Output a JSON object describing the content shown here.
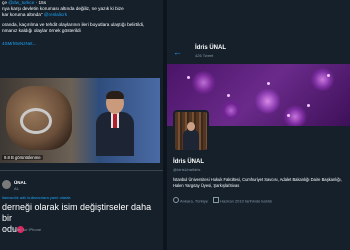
{
  "left": {
    "post_lines": [
      {
        "prefix": "çe",
        "link": "@dw_turkce",
        "rest": " · 15s"
      },
      {
        "prefix": "",
        "link": "",
        "rest": "nya karşı devletin koruması altında değiliz, ne yazık ki bize"
      },
      {
        "prefix": "",
        "link": "",
        "rest": "kar koruma altında\" "
      },
      {
        "prefix": "",
        "link": "",
        "rest": ""
      },
      {
        "prefix": "",
        "link": "",
        "rest": "oranda, kaçırılma ve tehdit olaylarının ileri boyutlara ulaştığı belirtildi,"
      },
      {
        "prefix": "",
        "link": "",
        "rest": "nmanız kaldığı olaylar örnek gösterildi"
      }
    ],
    "post_link": "@reslalicrk",
    "quote_link": "4SMrh9vNzNet...",
    "views": "9.8 B görüntülenme",
    "tweet2": {
      "name": "ÜNAL",
      "handle": "AL",
      "reply_prefix": "llamacılık adlı kullanıcılara yanıt olarak",
      "text": "derneği olarak isim değiştirseler daha bir",
      "text2": "odu",
      "meta": "15 · Twitter for iPhone"
    }
  },
  "right": {
    "top_name": "İdris ÜNAL",
    "top_count": "426 Tweet",
    "name": "İdris ÜNAL",
    "handle": "@IdrisUnalIdris",
    "bio": "İstanbul Üniversitesi Hukuk Fakültesi, Cumhuriyet Savcısı, Adalet Bakanlığı Daire Başkanlığı, Halen Yargıtay Üyesi, Şarkışla/Sivas",
    "location": "Ankara, Türkiye",
    "joined": "Haziran 2010 tarihinde katıldı"
  }
}
